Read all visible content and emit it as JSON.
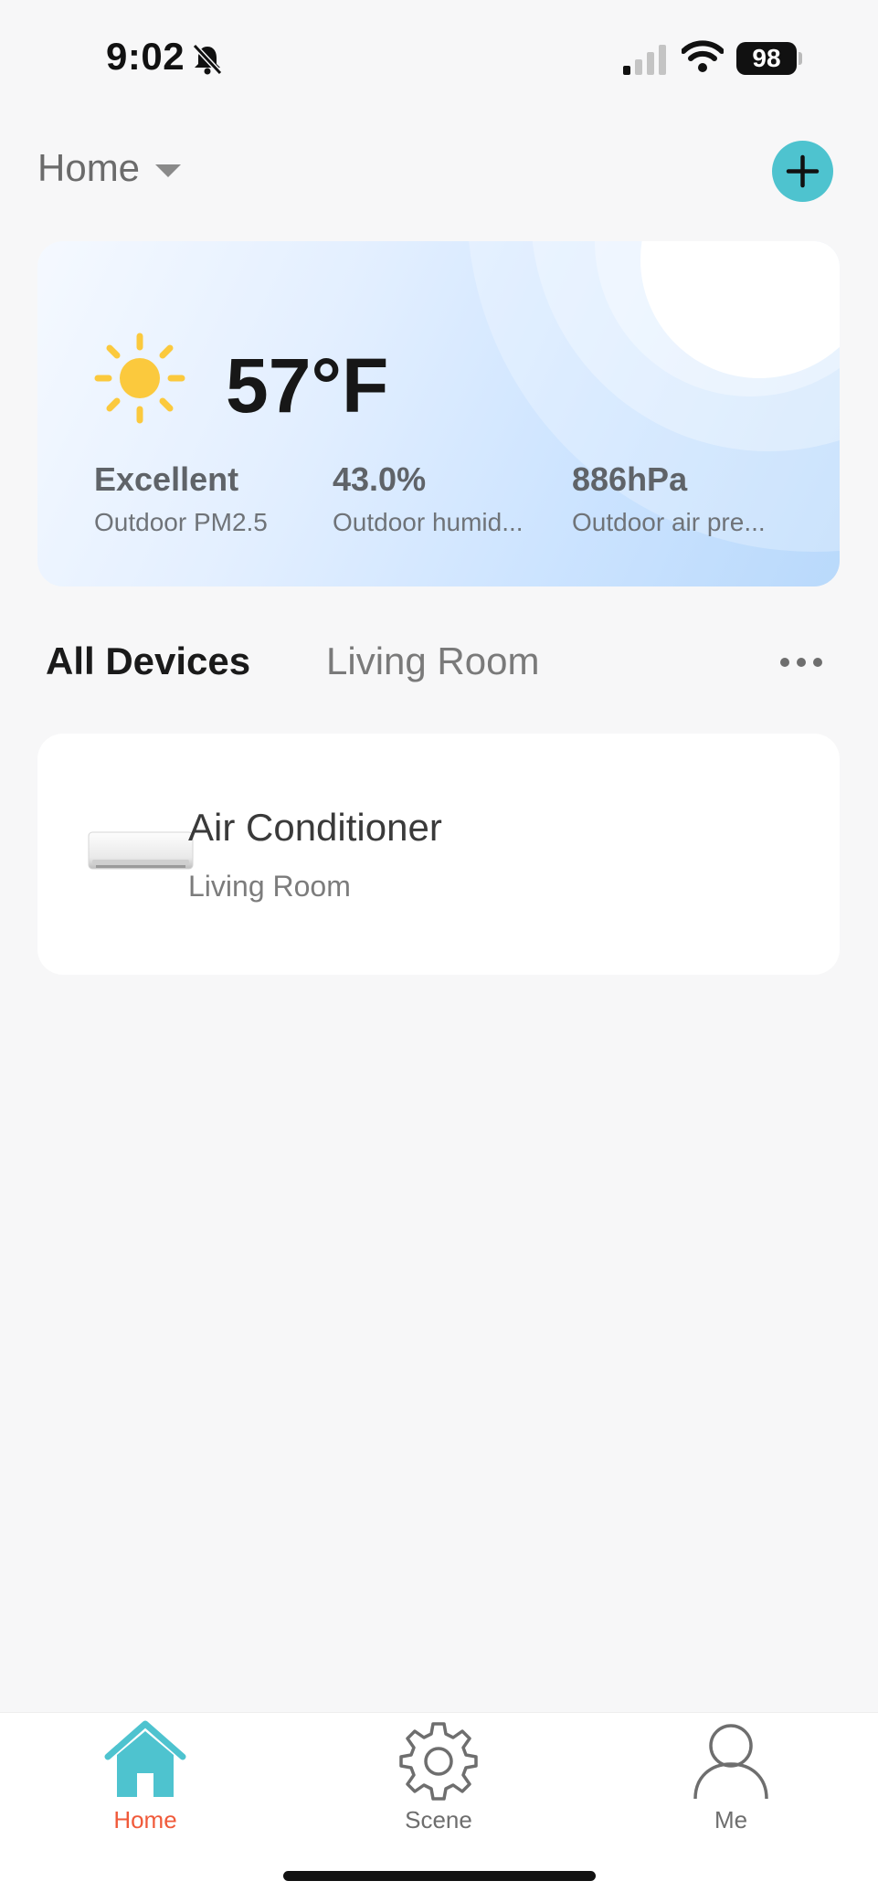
{
  "status_bar": {
    "time": "9:02",
    "battery": "98"
  },
  "header": {
    "title": "Home"
  },
  "weather": {
    "temperature": "57°F",
    "metrics": [
      {
        "value": "Excellent",
        "label": "Outdoor PM2.5"
      },
      {
        "value": "43.0%",
        "label": "Outdoor humid..."
      },
      {
        "value": "886hPa",
        "label": "Outdoor air pre..."
      }
    ]
  },
  "tabs": [
    {
      "label": "All Devices",
      "active": true
    },
    {
      "label": "Living Room",
      "active": false
    }
  ],
  "devices": [
    {
      "name": "Air Conditioner",
      "room": "Living Room"
    }
  ],
  "tabbar": [
    {
      "label": "Home",
      "icon": "home-icon",
      "active": true
    },
    {
      "label": "Scene",
      "icon": "gear-icon",
      "active": false
    },
    {
      "label": "Me",
      "icon": "person-icon",
      "active": false
    }
  ],
  "colors": {
    "accent": "#4ec3cf",
    "active_tab_label": "#f05a3a"
  }
}
